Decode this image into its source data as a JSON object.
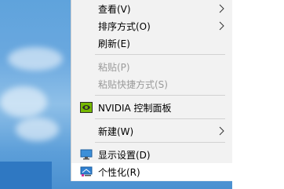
{
  "menu": {
    "items": [
      {
        "label": "查看(V)",
        "has_submenu": true,
        "disabled": false
      },
      {
        "label": "排序方式(O)",
        "has_submenu": true,
        "disabled": false
      },
      {
        "label": "刷新(E)",
        "has_submenu": false,
        "disabled": false
      },
      {
        "label": "粘贴(P)",
        "has_submenu": false,
        "disabled": true
      },
      {
        "label": "粘贴快捷方式(S)",
        "has_submenu": false,
        "disabled": true
      },
      {
        "label": "NVIDIA 控制面板",
        "has_submenu": false,
        "disabled": false,
        "icon": "nvidia-logo-icon"
      },
      {
        "label": "新建(W)",
        "has_submenu": true,
        "disabled": false
      },
      {
        "label": "显示设置(D)",
        "has_submenu": false,
        "disabled": false,
        "icon": "display-icon"
      },
      {
        "label": "个性化(R)",
        "has_submenu": false,
        "disabled": false,
        "icon": "personalize-icon",
        "highlighted": true
      }
    ]
  },
  "colors": {
    "menu_background": "#f2f2f2",
    "disabled_text": "#9a9a9a",
    "nvidia_green": "#76b900"
  }
}
